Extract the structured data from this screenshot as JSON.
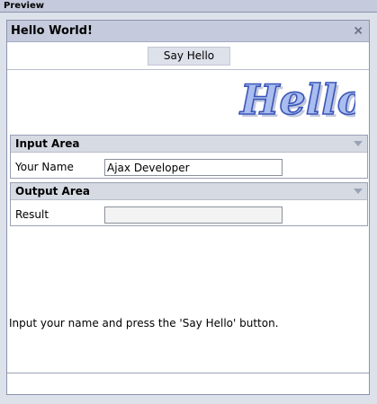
{
  "preview_panel": {
    "title": "Preview"
  },
  "window": {
    "title": "Hello World!",
    "close_icon": "close-icon"
  },
  "toolbar": {
    "say_hello_label": "Say Hello"
  },
  "logo": {
    "text": "Hello",
    "colors": {
      "fill": "#a9bdf0",
      "stroke": "#3b55b8",
      "shadow": "#9aa4c8"
    }
  },
  "input_area": {
    "title": "Input Area",
    "name_label": "Your Name",
    "name_value": "Ajax Developer",
    "collapse_icon": "chevron-down-icon"
  },
  "output_area": {
    "title": "Output Area",
    "result_label": "Result",
    "result_value": "",
    "collapse_icon": "chevron-down-icon"
  },
  "instructions": "Input your name and press the 'Say Hello' button.",
  "colors": {
    "background": "#dde1ea",
    "header": "#c5cbdc",
    "group_header": "#d5dae3",
    "border": "#8a93ad"
  }
}
